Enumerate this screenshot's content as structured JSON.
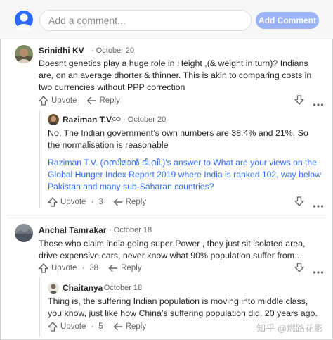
{
  "composer": {
    "placeholder": "Add a comment...",
    "add_label": "Add Comment",
    "accent": "#2e69ff"
  },
  "comments": [
    {
      "author": "Srinidhi KV",
      "date": "October 20",
      "text": "Doesnt genetics play a huge role in Height ,(& weight in turn)? Indians are, on an average dhorter & thinner. This is akin to comparing costs in two currencies without PPP correction",
      "upvote": "Upvote",
      "reply": "Reply",
      "replies": [
        {
          "author": "Raziman T.V.",
          "date": "October 20",
          "text": "No, The Indian government’s own numbers are 38.4% and 21%. So the normalisation is reasonable",
          "link": "Raziman T.V. (റസിമാൻ ടി.വി.)'s answer to What are your views on the Global Hunger Index Report 2019 where India is ranked 102, way below Pakistan and many sub-Saharan countries?",
          "upvote": "Upvote",
          "upvote_count": "3",
          "reply": "Reply"
        }
      ]
    },
    {
      "author": "Anchal Tamrakar",
      "date": "October 18",
      "text": "Those who claim india going super Power , they just sit isolated area, drive expensive cars, never know what 90% population suffer from....",
      "upvote": "Upvote",
      "upvote_count": "38",
      "reply": "Reply",
      "replies": [
        {
          "author": "Chaitanya",
          "date": "October 18",
          "text": "Thing is, the suffering Indian population is moving into middle class, you know, just like how China’s suffering population did, 20 years ago.",
          "upvote": "Upvote",
          "upvote_count": "5",
          "reply": "Reply"
        }
      ]
    }
  ],
  "watermark": "知乎 @燃路花影"
}
